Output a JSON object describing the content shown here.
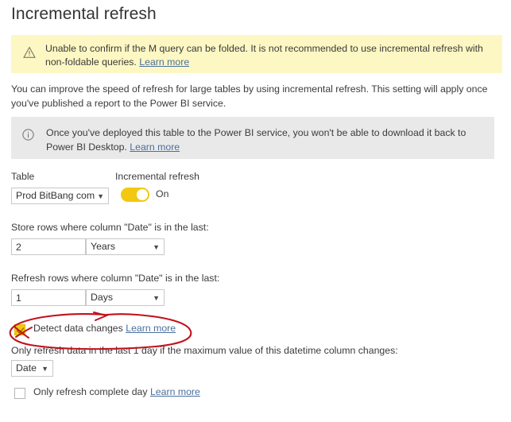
{
  "page": {
    "title": "Incremental refresh"
  },
  "warning_banner": {
    "icon": "warning-triangle-icon",
    "text": "Unable to confirm if the M query can be folded. It is not recommended to use incremental refresh with non-foldable queries.",
    "link_label": "Learn more",
    "background_color": "#fdf7c4"
  },
  "intro": {
    "text": "You can improve the speed of refresh for large tables by using incremental refresh. This setting will apply once you've published a report to the Power BI service."
  },
  "info_banner": {
    "icon": "info-circle-icon",
    "text": "Once you've deployed this table to the Power BI service, you won't be able to download it back to Power BI Desktop.",
    "link_label": "Learn more",
    "background_color": "#e9e9e9"
  },
  "table_field": {
    "label": "Table",
    "value": "Prod BitBang com",
    "caret": "▼"
  },
  "incremental_refresh_toggle": {
    "label": "Incremental refresh",
    "state_label": "On",
    "on_color": "#f2c811"
  },
  "store_rows": {
    "label": "Store rows where column \"Date\" is in the last:",
    "amount": "2",
    "unit": "Years",
    "caret": "▼"
  },
  "refresh_rows": {
    "label": "Refresh rows where column \"Date\" is in the last:",
    "amount": "1",
    "unit": "Days",
    "caret": "▼"
  },
  "detect_data_changes": {
    "label": "Detect data changes",
    "link_label": "Learn more",
    "checked": true
  },
  "datetime_column": {
    "label": "Only refresh data in the last 1 day if the maximum value of this datetime column changes:",
    "value": "Date",
    "caret": "▼"
  },
  "complete_day": {
    "label": "Only refresh complete day",
    "link_label": "Learn more",
    "checked": false
  },
  "annotation": {
    "type": "hand-drawn-red-ellipse",
    "color": "#c1121c",
    "target": "detect-data-changes-row"
  }
}
